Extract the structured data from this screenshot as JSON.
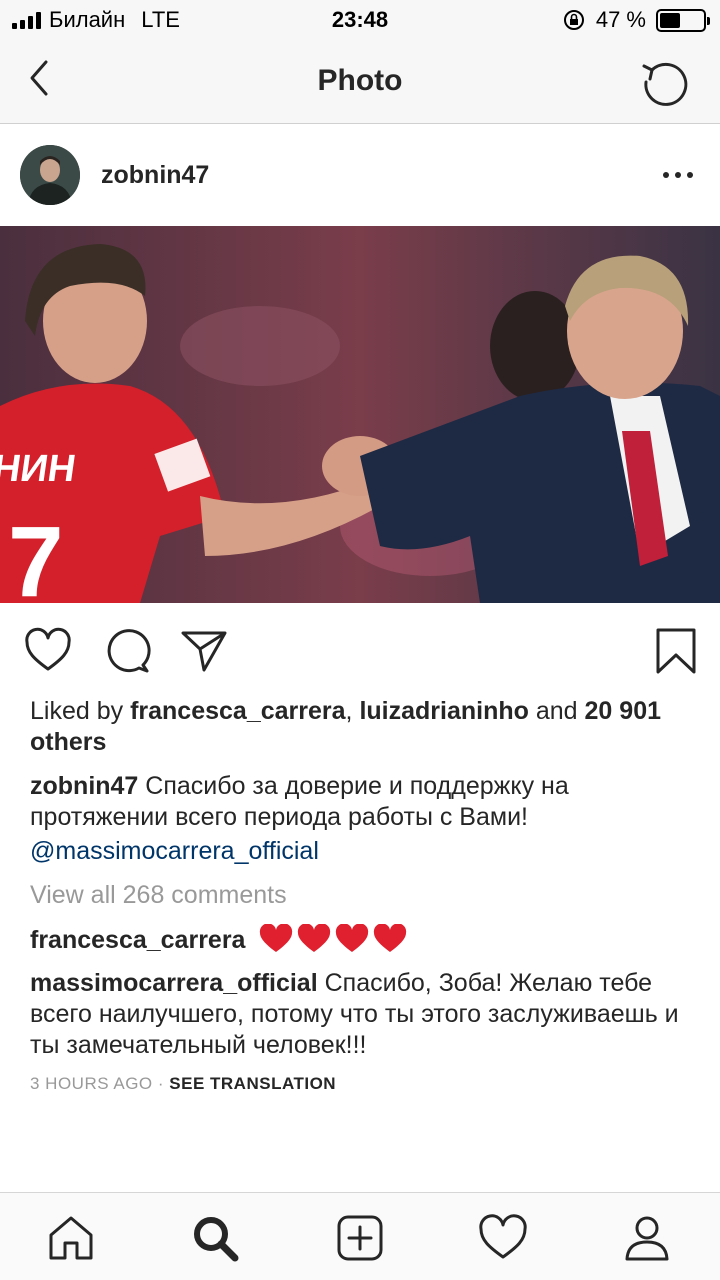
{
  "status_bar": {
    "carrier": "Билайн",
    "network": "LTE",
    "time": "23:48",
    "battery_percent": "47 %",
    "battery_level": 0.47
  },
  "nav": {
    "title": "Photo",
    "back_icon": "chevron-left-icon",
    "refresh_icon": "refresh-icon"
  },
  "post": {
    "username": "zobnin47",
    "more_icon": "more-horizontal-icon",
    "likes": {
      "prefix": "Liked by",
      "user1": "francesca_carrera",
      "separator": ",",
      "user2": "luizadrianinho",
      "joiner": "and",
      "others": "20 901 others"
    },
    "caption": {
      "author": "zobnin47",
      "text": "Спасибо за доверие и поддержку на протяжении всего периода работы с Вами!",
      "mention": "@massimocarrera_official"
    },
    "view_all": "View all 268 comments",
    "comments": [
      {
        "author": "francesca_carrera",
        "text": "",
        "hearts": 4
      },
      {
        "author": "massimocarrera_official",
        "text": "Спасибо, Зоба! Желаю тебе всего наилучшего, потому что ты этого заслуживаешь и ты замечательный человек!!!"
      }
    ],
    "time_ago": "3 HOURS AGO",
    "dot": "·",
    "see_translation": "SEE TRANSLATION"
  },
  "colors": {
    "text": "#262626",
    "link": "#003569",
    "muted": "#999999",
    "heart": "#e0202e",
    "bar_bg": "#f7f7f7"
  },
  "tabs": [
    "home-icon",
    "search-icon",
    "add-post-icon",
    "activity-heart-icon",
    "profile-icon"
  ]
}
